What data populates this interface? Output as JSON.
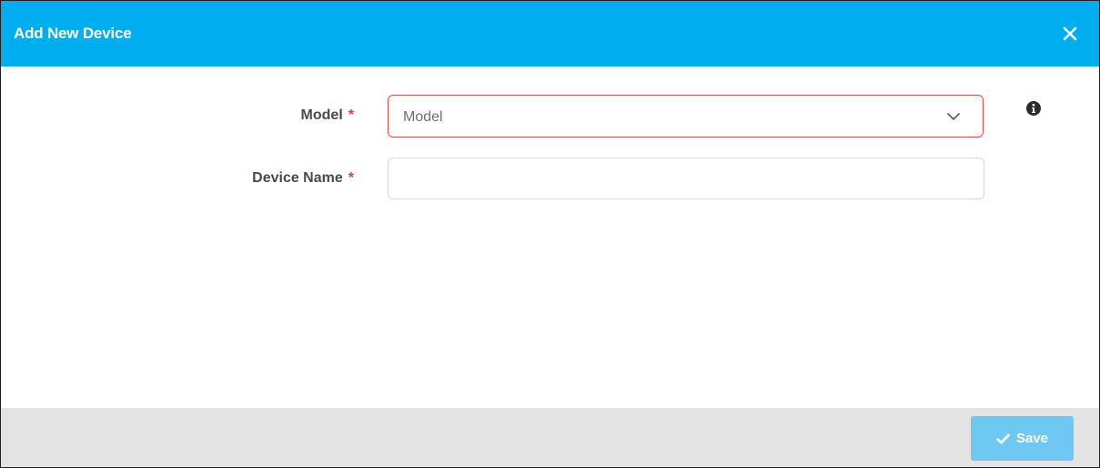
{
  "dialog": {
    "title": "Add New Device",
    "close_icon": "close-icon"
  },
  "form": {
    "model": {
      "label": "Model",
      "required_mark": "*",
      "placeholder": "Model",
      "value": ""
    },
    "device_name": {
      "label": "Device Name",
      "required_mark": "*",
      "placeholder": "",
      "value": ""
    },
    "info_icon": "info-icon"
  },
  "footer": {
    "save_label": "Save",
    "save_icon": "check-icon"
  },
  "colors": {
    "header_bg": "#00aeef",
    "error_border": "#e24b4b",
    "required": "#e03b3b",
    "save_bg": "#6fc8f2",
    "footer_bg": "#e3e3e3"
  }
}
